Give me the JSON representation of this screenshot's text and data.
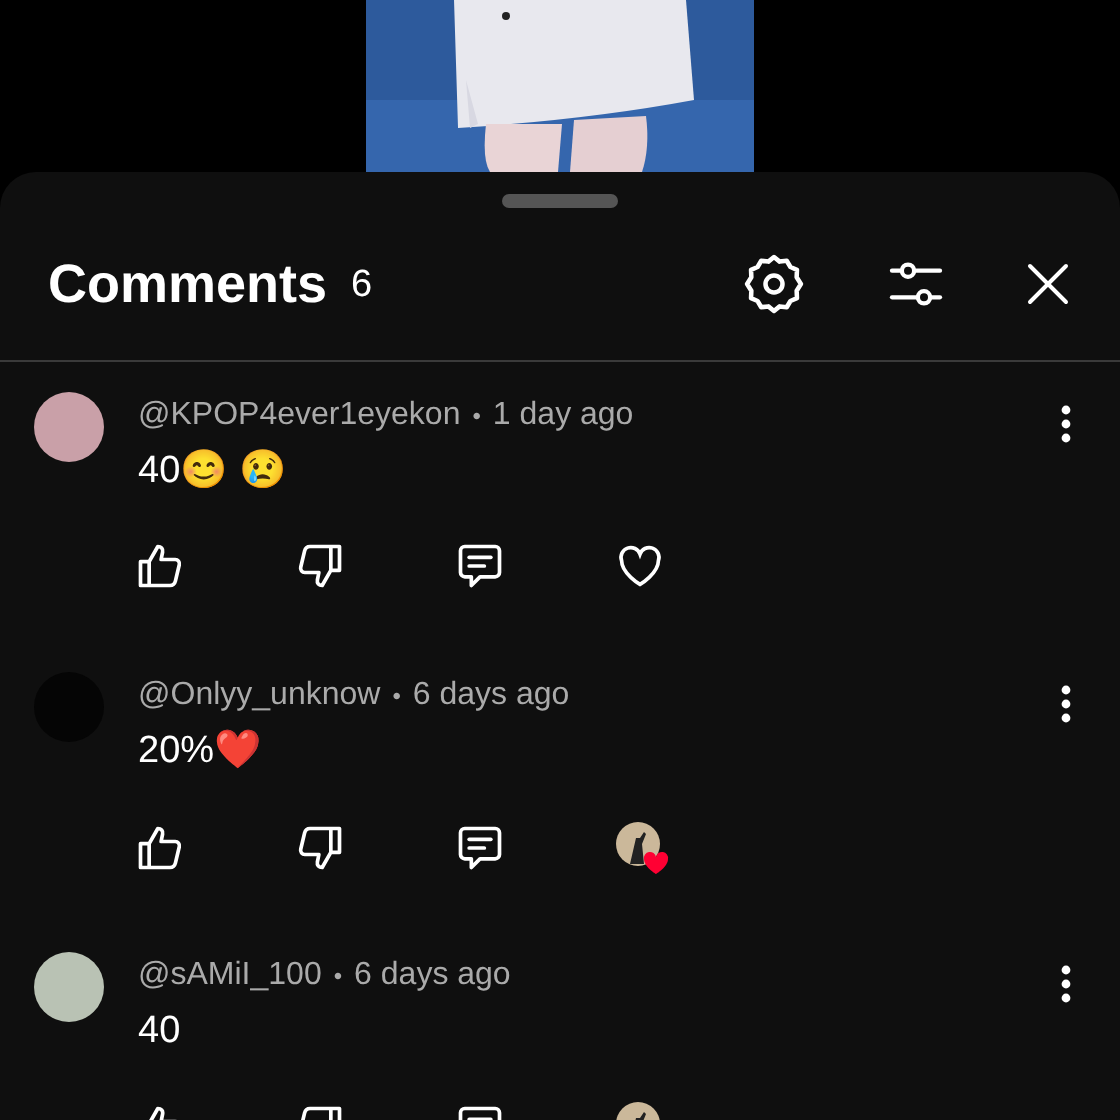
{
  "header": {
    "title": "Comments",
    "count": "6"
  },
  "comments": [
    {
      "author": "@KPOP4ever1eyekon",
      "separator": "•",
      "time": "1 day ago",
      "text": "40😊 😢",
      "creator_hearted": false
    },
    {
      "author": "@Onlyy_unknow",
      "separator": "•",
      "time": "6 days ago",
      "text": "20%❤️",
      "creator_hearted": true
    },
    {
      "author": "@sAMiI_100",
      "separator": "•",
      "time": "6 days ago",
      "text": "40",
      "creator_hearted": true
    }
  ]
}
